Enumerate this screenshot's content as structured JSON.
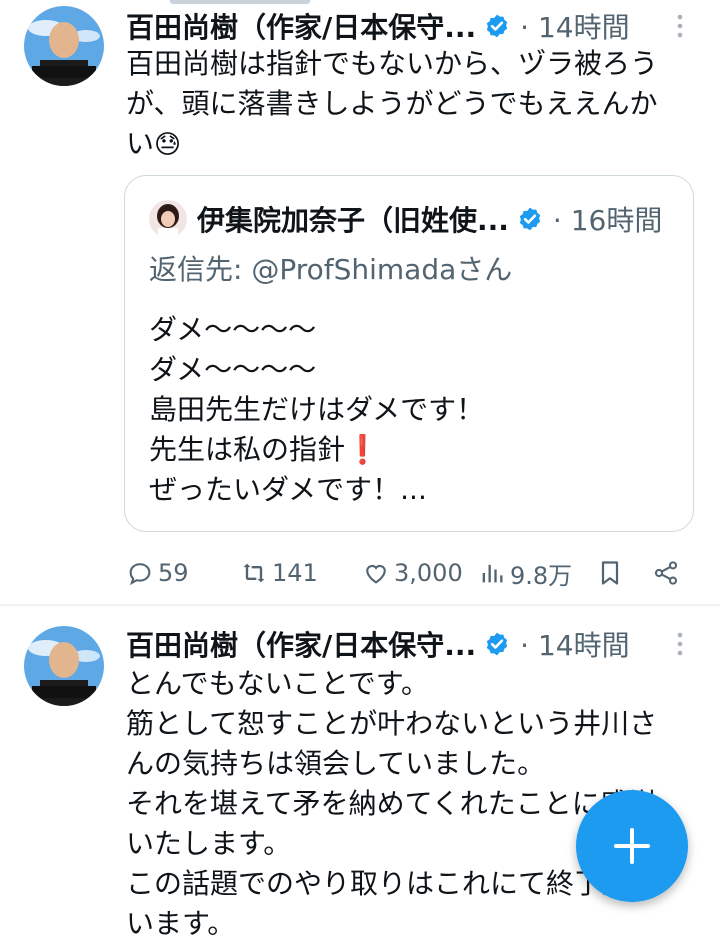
{
  "tweets": [
    {
      "author": "百田尚樹（作家/日本保守...",
      "time": "14時間",
      "text_lines": [
        "百田尚樹は指針でもないから、ヅラ被ろう",
        "が、頭に落書きしようがどうでもええんか",
        "い"
      ],
      "text_emoji": "😓",
      "quote": {
        "author": "伊集院加奈子（旧姓使...",
        "time": "16時間",
        "reply_to": "返信先: @ProfShimadaさん",
        "lines": [
          "ダメ〜〜〜〜",
          "ダメ〜〜〜〜",
          "島田先生だけはダメです！",
          "先生は私の指針",
          "ぜったいダメです！..."
        ],
        "emoji": "❗"
      },
      "stats": {
        "replies": "59",
        "retweets": "141",
        "likes": "3,000",
        "views": "9.8万"
      }
    },
    {
      "author": "百田尚樹（作家/日本保守...",
      "time": "14時間",
      "text_lines": [
        "とんでもないことです。",
        "筋として恕すことが叶わないという井川さ",
        "んの気持ちは領会していました。",
        "それを堪えて矛を納めてくれたことに感謝",
        "いたします。",
        "この話題でのやり取りはこれにて終了願",
        "います。"
      ]
    }
  ],
  "avatar_caption": "百田尚樹",
  "colors": {
    "accent": "#1d9bf0",
    "muted": "#536471",
    "border": "#cfd9de",
    "text": "#0f1419"
  },
  "icons": [
    "verified-icon",
    "more-icon",
    "reply-icon",
    "retweet-icon",
    "like-icon",
    "views-icon",
    "bookmark-icon",
    "share-icon",
    "compose-plus-icon"
  ]
}
